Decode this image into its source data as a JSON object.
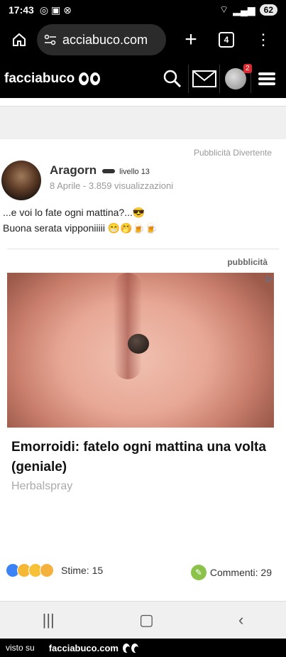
{
  "status": {
    "time": "17:43",
    "battery": "62"
  },
  "browser": {
    "url": "acciabuco.com",
    "tabs_count": "4"
  },
  "site": {
    "logo": "facciabuco",
    "notifications": "2"
  },
  "post": {
    "category": "Pubblicità Divertente",
    "author": "Aragorn",
    "level": "livello 13",
    "meta": "8 Aprile - 3.859 visualizzazioni",
    "text_line1": "...e voi lo fate ogni mattina?...😎",
    "text_line2": "Buona serata vipponiiiii 😁🤭🍺🍺"
  },
  "ad": {
    "label": "pubblicità",
    "title": "Emorroidi: fatelo ogni mattina una volta (geniale)",
    "source": "Herbalspray"
  },
  "footer_stats": {
    "stime": "Stime: 15",
    "commenti": "Commenti: 29"
  },
  "footer": {
    "visto": "visto su",
    "site": "facciabuco.com"
  }
}
